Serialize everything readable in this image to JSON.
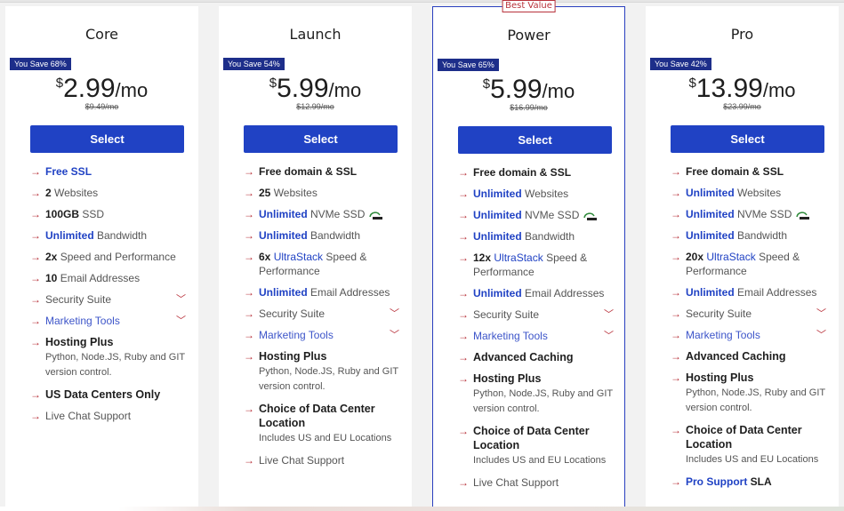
{
  "plans": [
    {
      "name": "Core",
      "save_badge": "You Save 68%",
      "currency": "$",
      "price": "2.99",
      "period": "/mo",
      "original_price": "$9.49/mo",
      "select_label": "Select",
      "featured": false,
      "features": [
        {
          "bold": "Free SSL",
          "bold_blue": true,
          "text": ""
        },
        {
          "bold": "2",
          "text": " Websites"
        },
        {
          "bold": "100GB",
          "text": " SSD"
        },
        {
          "bold": "Unlimited",
          "bold_blue": true,
          "text": " Bandwidth"
        },
        {
          "bold": "2x",
          "text": " Speed and Performance"
        },
        {
          "bold": "10",
          "text": " Email Addresses"
        },
        {
          "text": "Security Suite",
          "dropdown": true
        },
        {
          "text": "Marketing Tools",
          "dropdown": true,
          "link": true
        },
        {
          "title": "Hosting Plus",
          "sub": "Python,  Node.JS,  Ruby and GIT version control."
        },
        {
          "title": "US Data Centers Only"
        },
        {
          "text": "Live Chat Support"
        }
      ]
    },
    {
      "name": "Launch",
      "save_badge": "You Save 54%",
      "currency": "$",
      "price": "5.99",
      "period": "/mo",
      "original_price": "$12.99/mo",
      "select_label": "Select",
      "featured": false,
      "features": [
        {
          "bold": "Free domain & SSL",
          "text": ""
        },
        {
          "bold": "25",
          "text": " Websites"
        },
        {
          "bold": "Unlimited",
          "bold_blue": true,
          "text": " NVMe SSD",
          "nvme_icon": true
        },
        {
          "bold": "Unlimited",
          "bold_blue": true,
          "text": " Bandwidth"
        },
        {
          "bold": "6x",
          "ultrastack": "UltraStack",
          "text": " Speed & Performance"
        },
        {
          "bold": "Unlimited",
          "bold_blue": true,
          "text": " Email Addresses"
        },
        {
          "text": "Security Suite",
          "dropdown": true
        },
        {
          "text": "Marketing Tools",
          "dropdown": true,
          "link": true
        },
        {
          "title": "Hosting Plus",
          "sub": "Python,  Node.JS,  Ruby and GIT version control."
        },
        {
          "title": "Choice of Data Center Location",
          "sub": "Includes US and EU Locations"
        },
        {
          "text": "Live Chat Support"
        }
      ]
    },
    {
      "name": "Power",
      "best_value": "Best Value",
      "save_badge": "You Save 65%",
      "currency": "$",
      "price": "5.99",
      "period": "/mo",
      "original_price": "$16.99/mo",
      "select_label": "Select",
      "featured": true,
      "features": [
        {
          "bold": "Free domain & SSL",
          "text": ""
        },
        {
          "bold": "Unlimited",
          "bold_blue": true,
          "text": " Websites"
        },
        {
          "bold": "Unlimited",
          "bold_blue": true,
          "text": " NVMe SSD",
          "nvme_icon": true
        },
        {
          "bold": "Unlimited",
          "bold_blue": true,
          "text": " Bandwidth"
        },
        {
          "bold": "12x",
          "ultrastack": "UltraStack",
          "text": " Speed & Performance"
        },
        {
          "bold": "Unlimited",
          "bold_blue": true,
          "text": " Email Addresses"
        },
        {
          "text": "Security Suite",
          "dropdown": true
        },
        {
          "text": "Marketing Tools",
          "dropdown": true,
          "link": true
        },
        {
          "title": "Advanced Caching"
        },
        {
          "title": "Hosting Plus",
          "sub": "Python,  Node.JS,  Ruby and GIT version control."
        },
        {
          "title": "Choice of Data Center Location",
          "sub": "Includes US and EU Locations"
        },
        {
          "text": "Live Chat Support"
        }
      ]
    },
    {
      "name": "Pro",
      "save_badge": "You Save 42%",
      "currency": "$",
      "price": "13.99",
      "period": "/mo",
      "original_price": "$23.99/mo",
      "select_label": "Select",
      "featured": false,
      "features": [
        {
          "bold": "Free domain & SSL",
          "text": ""
        },
        {
          "bold": "Unlimited",
          "bold_blue": true,
          "text": " Websites"
        },
        {
          "bold": "Unlimited",
          "bold_blue": true,
          "text": " NVMe SSD",
          "nvme_icon": true
        },
        {
          "bold": "Unlimited",
          "bold_blue": true,
          "text": " Bandwidth"
        },
        {
          "bold": "20x",
          "ultrastack": "UltraStack",
          "text": " Speed & Performance"
        },
        {
          "bold": "Unlimited",
          "bold_blue": true,
          "text": " Email Addresses"
        },
        {
          "text": "Security Suite",
          "dropdown": true
        },
        {
          "text": "Marketing Tools",
          "dropdown": true,
          "link": true
        },
        {
          "title": "Advanced Caching"
        },
        {
          "title": "Hosting Plus",
          "sub": "Python,  Node.JS,  Ruby and GIT version control."
        },
        {
          "title": "Choice of Data Center Location",
          "sub": "Includes US and EU Locations"
        },
        {
          "bold": "Pro Support",
          "bold_blue": true,
          "suffix_bold": " SLA"
        }
      ]
    }
  ],
  "icons": {
    "arrow": "→",
    "chevron": "﹀"
  },
  "colors": {
    "accent_blue": "#2042c4",
    "badge_navy": "#1d2e8a",
    "accent_red": "#b8323b"
  }
}
